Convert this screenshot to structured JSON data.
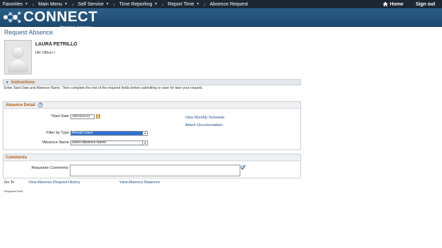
{
  "topnav": {
    "items": [
      "Favorites",
      "Main Menu",
      "Self Service",
      "Time Reporting",
      "Report Time",
      "Absence Request"
    ],
    "home": "Home",
    "signout": "Sign out"
  },
  "brand": {
    "name": "CONNECT",
    "sub": "Maryland Judiciary"
  },
  "page": {
    "title": "Request Absence"
  },
  "employee": {
    "name": "LAURA PETRILLO",
    "title": "HR Officer I"
  },
  "instructions": {
    "label": "Instructions",
    "text": "Enter Start Date and Absence Name. Then complete the rest of the required fields before submitting or save for later your request."
  },
  "absence_detail": {
    "label": "Absence Detail",
    "start_date_label": "*Start Date",
    "start_date_value": "09/29/2015",
    "filter_label": "Filter by Type",
    "filter_value": "Annual Leave",
    "absence_name_label": "*Absence Name",
    "absence_name_value": "Select Absence Name",
    "view_schedule": "View Monthly Schedule",
    "attach_docs": "Attach Documentation"
  },
  "comments": {
    "label": "Comments",
    "requestor_label": "Requestor Comments",
    "requestor_value": ""
  },
  "goto": {
    "label": "Go To",
    "history": "View Absence Request History",
    "balances": "View Absence Balances"
  },
  "required_note": "* Required Field",
  "colors": {
    "nav": "#1c2733",
    "banner": "#1d4a70",
    "section_label": "#b35c10",
    "link": "#1f4f8a"
  }
}
